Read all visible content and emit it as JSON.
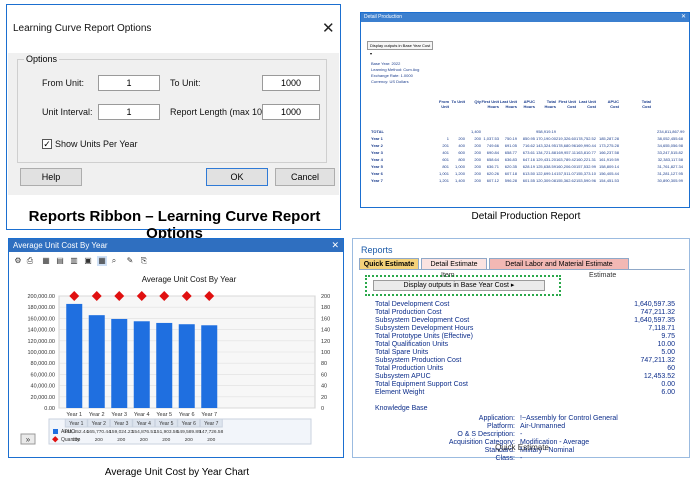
{
  "dialog": {
    "title": "Learning Curve Report Options",
    "close": "✕",
    "group_label": "Options",
    "from_unit_label": "From Unit:",
    "from_unit_value": "1",
    "to_unit_label": "To Unit:",
    "to_unit_value": "1000",
    "interval_label": "Unit Interval:",
    "interval_value": "1",
    "report_length_label": "Report Length (max 1000):",
    "report_length_value": "1000",
    "show_units_label": "Show Units Per Year",
    "show_units_checked": "✓",
    "help": "Help",
    "ok": "OK",
    "cancel": "Cancel",
    "caption": "Reports Ribbon – Learning Curve Report Options"
  },
  "detail": {
    "title": "Detail Production",
    "close": "✕",
    "dropdown": "Display outputs in Base Year Cost ▾",
    "meta": [
      "Base Year: 2022",
      "Learning Method: Cum Avg",
      "Exchange Rate: 1.0000",
      "Currency: US Dollars"
    ],
    "headers": [
      "From Unit",
      "To Unit",
      "Qty",
      "First Unit Hours",
      "Last Unit Hours",
      "APUC Hours",
      "Total Hours",
      "First Unit Cost",
      "Last Unit Cost",
      "APUC Cost",
      "Total Cost"
    ],
    "rows": [
      {
        "label": "TOTAL",
        "cells": [
          "",
          "",
          "1,400",
          "",
          "",
          "",
          "958,919.19",
          "",
          "",
          "",
          "234,811,867.99"
        ]
      },
      {
        "label": "Year 1",
        "cells": [
          "1",
          "200",
          "200",
          "1,037.53",
          "750.19",
          "850.95",
          "170,190.00",
          "219,326.60",
          "178,752.52",
          "185,287.28",
          "38,052,455.68"
        ]
      },
      {
        "label": "Year 2",
        "cells": [
          "201",
          "400",
          "200",
          "749.66",
          "691.05",
          "716.62",
          "143,324.95",
          "178,680.96",
          "169,990.44",
          "173,275.28",
          "34,655,056.98"
        ]
      },
      {
        "label": "Year 3",
        "cells": [
          "401",
          "600",
          "200",
          "690.84",
          "658.77",
          "673.61",
          "134,721.88",
          "169,957.11",
          "163,810.77",
          "166,237.58",
          "33,247,515.82"
        ]
      },
      {
        "label": "Year 4",
        "cells": [
          "601",
          "800",
          "200",
          "658.64",
          "636.83",
          "647.16",
          "129,431.20",
          "163,789.42",
          "160,221.31",
          "161,919.59",
          "32,383,117.58"
        ]
      },
      {
        "label": "Year 5",
        "cells": [
          "801",
          "1,000",
          "200",
          "636.71",
          "620.35",
          "628.19",
          "125,638.59",
          "160,206.00",
          "157,532.99",
          "158,809.14",
          "31,761,827.34"
        ]
      },
      {
        "label": "Year 6",
        "cells": [
          "1,001",
          "1,200",
          "200",
          "620.26",
          "607.18",
          "613.50",
          "122,699.14",
          "157,511.07",
          "155,373.10",
          "156,405.44",
          "31,281,127.95"
        ]
      },
      {
        "label": "Year 7",
        "cells": [
          "1,201",
          "1,400",
          "200",
          "607.12",
          "596.28",
          "601.55",
          "120,309.08",
          "155,362.62",
          "153,590.96",
          "154,451.53",
          "30,890,305.99"
        ]
      }
    ],
    "caption": "Detail Production Report"
  },
  "chart_panel": {
    "title": "Average Unit Cost By Year",
    "close": "✕",
    "caption": "Average Unit Cost by Year Chart",
    "expand_btn": "»",
    "row_labels": [
      "APUC",
      "Quantity"
    ],
    "apuc_display": [
      "185,852.44",
      "165,770.44",
      "159,024.23",
      "154,876.51",
      "151,903.58",
      "149,589.89",
      "147,726.58"
    ],
    "qty_display": [
      "200",
      "200",
      "200",
      "200",
      "200",
      "200",
      "200"
    ]
  },
  "chart_data": {
    "type": "bar",
    "title": "Average Unit Cost By Year",
    "categories": [
      "Year 1",
      "Year 2",
      "Year 3",
      "Year 4",
      "Year 5",
      "Year 6",
      "Year 7"
    ],
    "series": [
      {
        "name": "APUC",
        "type": "bar",
        "axis": "left",
        "values": [
          185852.44,
          165770.44,
          159024.23,
          154876.51,
          151903.58,
          149589.89,
          147726.58
        ]
      },
      {
        "name": "Quantity",
        "type": "scatter",
        "axis": "right",
        "values": [
          200,
          200,
          200,
          200,
          200,
          200,
          200
        ]
      }
    ],
    "ylim": [
      0,
      200000
    ],
    "y_ticks": [
      "200,000.00",
      "180,000.00",
      "160,000.00",
      "140,000.00",
      "120,000.00",
      "100,000.00",
      "80,000.00",
      "60,000.00",
      "40,000.00",
      "20,000.00",
      "0.00"
    ],
    "y2lim": [
      0,
      200
    ],
    "y2_ticks": [
      "200",
      "180",
      "160",
      "140",
      "120",
      "100",
      "80",
      "60",
      "40",
      "20",
      "0"
    ],
    "bar_color": "#1f6fe0",
    "marker_color": "#e01010",
    "grid": true
  },
  "reports": {
    "title": "Reports",
    "tabs": [
      "Quick Estimate",
      "Detail Estimate",
      "Detail Labor and Material Estimate"
    ],
    "item_header": "Item",
    "estimate_header": "Estimate",
    "display_btn": "Display outputs in Base Year Cost ▸",
    "rows": [
      {
        "label": "Total Development Cost",
        "value": "1,640,597.35"
      },
      {
        "label": "Total Production Cost",
        "value": "747,211.32"
      },
      {
        "label": "Subsystem Development Cost",
        "value": "1,640,597.35"
      },
      {
        "label": "Subsystem Development Hours",
        "value": "7,118.71"
      },
      {
        "label": "Total Prototype Units (Effective)",
        "value": "9.75"
      },
      {
        "label": "Total Qualification Units",
        "value": "10.00"
      },
      {
        "label": "Total Spare Units",
        "value": "5.00"
      },
      {
        "label": "Subsystem Production Cost",
        "value": "747,211.32"
      },
      {
        "label": "Total Production Units",
        "value": "60"
      },
      {
        "label": "Subsystem APUC",
        "value": "12,453.52"
      },
      {
        "label": "Total Equipment Support Cost",
        "value": "0.00"
      },
      {
        "label": "Element Weight",
        "value": "6.00"
      }
    ],
    "kb_title": "Knowledge Base",
    "kb": [
      {
        "key": "Application:",
        "value": "!~Assembly for Control General"
      },
      {
        "key": "Platform:",
        "value": "Air-Unmanned"
      },
      {
        "key": "O & S Description:",
        "value": "-"
      },
      {
        "key": "Acquisition Category:",
        "value": "Modification - Average"
      },
      {
        "key": "Standard:",
        "value": "Military - Nominal"
      },
      {
        "key": "Class:",
        "value": "-"
      }
    ],
    "footer": "Quick Estimate"
  }
}
